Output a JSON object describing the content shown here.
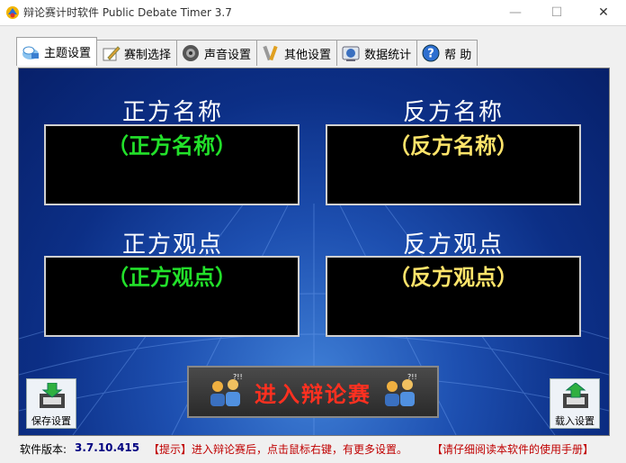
{
  "window": {
    "title": "辩论赛计时软件 Public Debate Timer 3.7",
    "min_glyph": "—",
    "max_glyph": "☐",
    "close_glyph": "✕"
  },
  "tabs": [
    {
      "label": "主题设置",
      "icon": "theme-icon",
      "active": true
    },
    {
      "label": "赛制选择",
      "icon": "pen-icon",
      "active": false
    },
    {
      "label": "声音设置",
      "icon": "speaker-icon",
      "active": false
    },
    {
      "label": "其他设置",
      "icon": "tools-icon",
      "active": false
    },
    {
      "label": "数据统计",
      "icon": "chart-icon",
      "active": false
    },
    {
      "label": "帮 助",
      "icon": "help-icon",
      "active": false
    }
  ],
  "main": {
    "affirmative_name_label": "正方名称",
    "affirmative_name_value": "（正方名称）",
    "negative_name_label": "反方名称",
    "negative_name_value": "（反方名称）",
    "affirmative_view_label": "正方观点",
    "affirmative_view_value": "（正方观点）",
    "negative_view_label": "反方观点",
    "negative_view_value": "（反方观点）",
    "enter_button": "进入辩论赛",
    "save_button": "保存设置",
    "load_button": "载入设置"
  },
  "colors": {
    "affirmative": "#22e02a",
    "negative": "#ffe46a",
    "enter_text": "#ff3020",
    "panel_blue": "#0c2f86"
  },
  "status": {
    "version_label": "软件版本:",
    "version_value": "3.7.10.415",
    "tip": "【提示】进入辩论赛后，点击鼠标右键，有更多设置。",
    "manual": "【请仔细阅读本软件的使用手册】"
  }
}
